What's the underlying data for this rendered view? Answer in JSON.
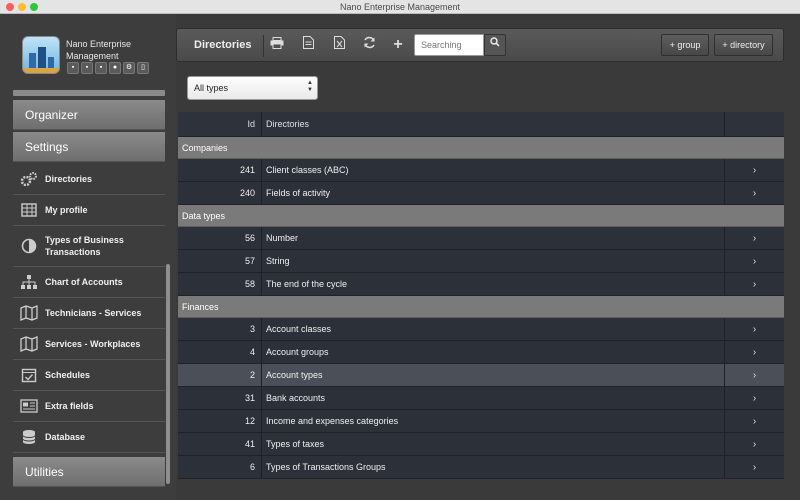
{
  "window": {
    "title": "Nano Enterprise Management"
  },
  "sidebar": {
    "app_name": "Nano Enterprise Management",
    "mini_icons": [
      "folder-icon",
      "print-icon",
      "shop-icon",
      "user-icon",
      "users-icon",
      "trash-icon"
    ],
    "sections": {
      "organizer": "Organizer",
      "settings": "Settings",
      "utilities": "Utilities"
    },
    "items": [
      {
        "label": "Directories",
        "icon": "gears-icon"
      },
      {
        "label": "My profile",
        "icon": "table-icon"
      },
      {
        "label": "Types of Business Transactions",
        "icon": "half-circle-icon"
      },
      {
        "label": "Chart of Accounts",
        "icon": "org-chart-icon"
      },
      {
        "label": "Technicians - Services",
        "icon": "map-icon"
      },
      {
        "label": "Services - Workplaces",
        "icon": "map-icon"
      },
      {
        "label": "Schedules",
        "icon": "calendar-check-icon"
      },
      {
        "label": "Extra fields",
        "icon": "newspaper-icon"
      },
      {
        "label": "Database",
        "icon": "database-icon"
      }
    ]
  },
  "toolbar": {
    "title": "Directories",
    "search_placeholder": "Searching",
    "add_group_label": "+ group",
    "add_directory_label": "+ directory"
  },
  "filter": {
    "selected": "All types"
  },
  "table": {
    "headers": {
      "id": "Id",
      "name": "Directories"
    },
    "groups": [
      {
        "name": "Companies",
        "rows": [
          {
            "id": "241",
            "name": "Client classes (ABC)"
          },
          {
            "id": "240",
            "name": "Fields of activity"
          }
        ]
      },
      {
        "name": "Data types",
        "rows": [
          {
            "id": "56",
            "name": "Number"
          },
          {
            "id": "57",
            "name": "String"
          },
          {
            "id": "58",
            "name": "The end of the cycle"
          }
        ]
      },
      {
        "name": "Finances",
        "rows": [
          {
            "id": "3",
            "name": "Account classes"
          },
          {
            "id": "4",
            "name": "Account groups"
          },
          {
            "id": "2",
            "name": "Account types",
            "highlight": true
          },
          {
            "id": "31",
            "name": "Bank accounts"
          },
          {
            "id": "12",
            "name": "Income and expenses categories"
          },
          {
            "id": "41",
            "name": "Types of taxes"
          },
          {
            "id": "6",
            "name": "Types of Transactions Groups"
          }
        ]
      }
    ]
  }
}
